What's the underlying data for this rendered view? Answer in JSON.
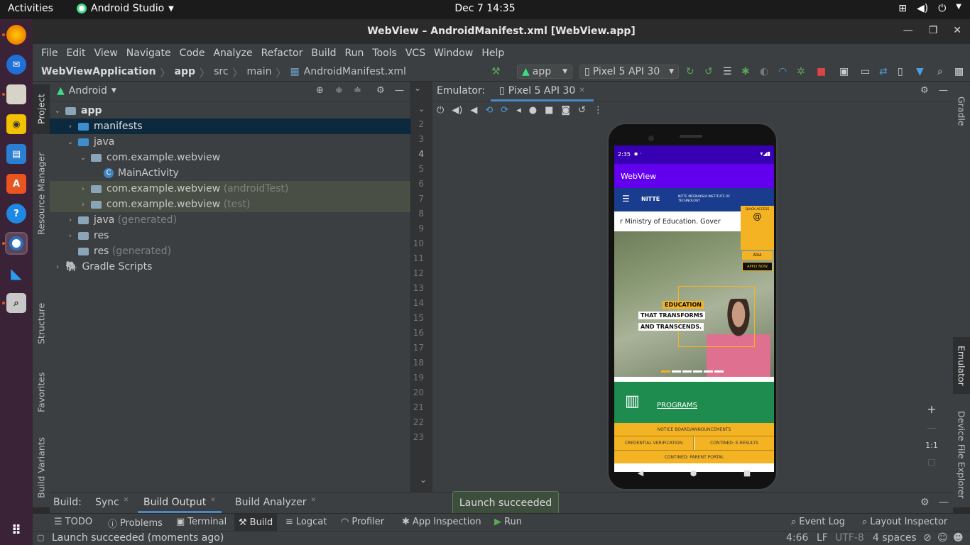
{
  "topbar": {
    "activities": "Activities",
    "app_name": "Android Studio",
    "clock": "Dec 7  14:35"
  },
  "window": {
    "title": "WebView – AndroidManifest.xml [WebView.app]"
  },
  "menu": [
    "File",
    "Edit",
    "View",
    "Navigate",
    "Code",
    "Analyze",
    "Refactor",
    "Build",
    "Run",
    "Tools",
    "VCS",
    "Window",
    "Help"
  ],
  "breadcrumb": {
    "project": "WebViewApplication",
    "module": "app",
    "src": "src",
    "main": "main",
    "file": "AndroidManifest.xml"
  },
  "toolbar": {
    "run_config": "app",
    "device": "Pixel 5 API 30"
  },
  "left_tabs": {
    "project": "Project",
    "resource_manager": "Resource Manager",
    "structure": "Structure",
    "favorites": "Favorites",
    "build_variants": "Build Variants"
  },
  "project_panel": {
    "view_mode": "Android",
    "tree": [
      {
        "label": "app",
        "suffix": "",
        "depth": 0
      },
      {
        "label": "manifests",
        "suffix": "",
        "depth": 1
      },
      {
        "label": "java",
        "suffix": "",
        "depth": 1
      },
      {
        "label": "com.example.webview",
        "suffix": "",
        "depth": 2
      },
      {
        "label": "MainActivity",
        "suffix": "",
        "depth": 3
      },
      {
        "label": "com.example.webview",
        "suffix": "(androidTest)",
        "depth": 2
      },
      {
        "label": "com.example.webview",
        "suffix": "(test)",
        "depth": 2
      },
      {
        "label": "java",
        "suffix": "(generated)",
        "depth": 1
      },
      {
        "label": "res",
        "suffix": "",
        "depth": 1
      },
      {
        "label": "res",
        "suffix": "(generated)",
        "depth": 1
      },
      {
        "label": "Gradle Scripts",
        "suffix": "",
        "depth": 0
      }
    ]
  },
  "gutter": {
    "line_numbers": [
      "2",
      "3",
      "4",
      "5",
      "6",
      "7",
      "8",
      "9",
      "10",
      "11",
      "12",
      "13",
      "14",
      "15",
      "16",
      "17",
      "18",
      "19",
      "20",
      "21",
      "22",
      "23"
    ]
  },
  "emulator": {
    "label": "Emulator:",
    "device_tab": "Pixel 5 API 30",
    "zoom_ratio": "1:1"
  },
  "right_tabs": {
    "gradle": "Gradle",
    "emulator": "Emulator",
    "device_file_explorer": "Device File Explorer"
  },
  "phone": {
    "status_time": "2:35",
    "appbar_title": "WebView",
    "logo": "NITTE",
    "institute": "NITTE MEENAKSHI INSTITUTE OF TECHNOLOGY",
    "ticker": "r Ministry of Education. Gover",
    "quick_access": "QUICK ACCESS",
    "aria": "ARIA",
    "apply_now": "APPLY NOW",
    "hero_line1": "EDUCATION",
    "hero_line2": "THAT TRANSFORMS",
    "hero_line3": "AND TRANSCENDS.",
    "programs": "PROGRAMS",
    "notice": "NOTICE BOARD/ANNOUNCEMENTS",
    "credential": "CREDENTIAL VERIFICATION",
    "eresults": "CONTINED: E-RESULTS",
    "parent_portal": "CONTINED: PARENT PORTAL"
  },
  "build_bar": {
    "label": "Build:",
    "tabs": [
      "Sync",
      "Build Output",
      "Build Analyzer"
    ]
  },
  "toast": "Launch succeeded",
  "bottom_tabs": [
    "TODO",
    "Problems",
    "Terminal",
    "Build",
    "Logcat",
    "Profiler",
    "App Inspection",
    "Run"
  ],
  "bottom_right": {
    "event_log": "Event Log",
    "layout_inspector": "Layout Inspector"
  },
  "status": {
    "message": "Launch succeeded (moments ago)",
    "position": "4:66",
    "line_sep": "LF",
    "encoding": "UTF-8",
    "indent": "4 spaces"
  },
  "colors": {
    "accent_purple": "#6200ee",
    "nitte_blue": "#1a3c8f",
    "nitte_yellow": "#f4b323",
    "programs_green": "#1e8c4e",
    "toast_green": "#3d4e3c"
  }
}
